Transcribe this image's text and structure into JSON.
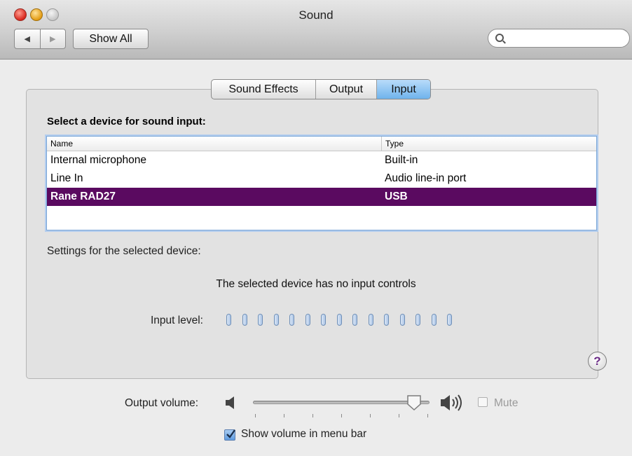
{
  "window": {
    "title": "Sound"
  },
  "toolbar": {
    "back_icon": "◀",
    "forward_icon": "▶",
    "show_all_label": "Show All",
    "search_value": ""
  },
  "tabs": [
    {
      "label": "Sound Effects",
      "selected": false
    },
    {
      "label": "Output",
      "selected": false
    },
    {
      "label": "Input",
      "selected": true
    }
  ],
  "input": {
    "section_title": "Select a device for sound input:",
    "columns": [
      "Name",
      "Type"
    ],
    "devices": [
      {
        "name": "Internal microphone",
        "type": "Built-in",
        "selected": false
      },
      {
        "name": "Line In",
        "type": "Audio line-in port",
        "selected": false
      },
      {
        "name": "Rane RAD27",
        "type": "USB",
        "selected": true
      }
    ],
    "settings_label": "Settings for the selected device:",
    "no_controls_message": "The selected device has no input controls",
    "input_level_label": "Input level:",
    "input_level_segments": 15,
    "input_level_lit": 0
  },
  "help": {
    "label": "?"
  },
  "output_volume": {
    "label": "Output volume:",
    "level": 0.95,
    "mute_label": "Mute",
    "muted": false
  },
  "menu_bar": {
    "show_volume_label": "Show volume in menu bar",
    "checked": true
  },
  "colors": {
    "selected_row": "#5a0a60",
    "selected_tab": "#6fb3ec",
    "help_glyph": "#6a2a86"
  }
}
